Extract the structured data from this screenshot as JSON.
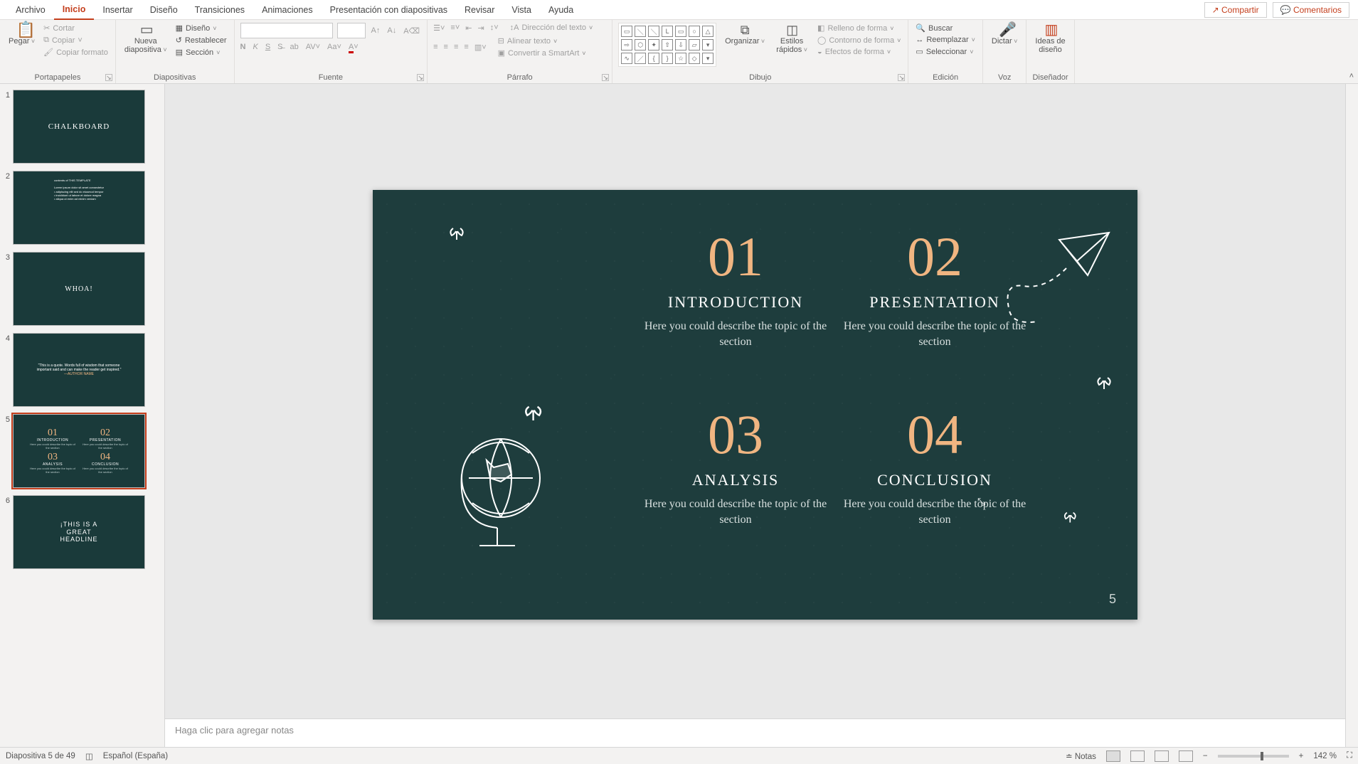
{
  "menu": {
    "file": "Archivo",
    "home": "Inicio",
    "insert": "Insertar",
    "design": "Diseño",
    "transitions": "Transiciones",
    "animations": "Animaciones",
    "slideshow": "Presentación con diapositivas",
    "review": "Revisar",
    "view": "Vista",
    "help": "Ayuda",
    "share": "Compartir",
    "comments": "Comentarios"
  },
  "ribbon": {
    "clipboard": {
      "label": "Portapapeles",
      "paste": "Pegar",
      "cut": "Cortar",
      "copy": "Copiar",
      "formatPainter": "Copiar formato"
    },
    "slides": {
      "label": "Diapositivas",
      "newSlide": "Nueva\ndiapositiva",
      "layout": "Diseño",
      "reset": "Restablecer",
      "section": "Sección"
    },
    "font": {
      "label": "Fuente",
      "name": "",
      "size": ""
    },
    "paragraph": {
      "label": "Párrafo",
      "textDir": "Dirección del texto",
      "alignText": "Alinear texto",
      "smartArt": "Convertir a SmartArt"
    },
    "drawing": {
      "label": "Dibujo",
      "arrange": "Organizar",
      "quickStyles": "Estilos\nrápidos",
      "shapeFill": "Relleno de forma",
      "shapeOutline": "Contorno de forma",
      "shapeEffects": "Efectos de forma"
    },
    "editing": {
      "label": "Edición",
      "find": "Buscar",
      "replace": "Reemplazar",
      "select": "Seleccionar"
    },
    "voice": {
      "label": "Voz",
      "dictate": "Dictar"
    },
    "designer": {
      "label": "Diseñador",
      "ideas": "Ideas de\ndiseño"
    }
  },
  "slide": {
    "pageNumber": "5",
    "sections": [
      {
        "num": "01",
        "title": "INTRODUCTION",
        "desc": "Here you could describe the topic of the section"
      },
      {
        "num": "02",
        "title": "PRESENTATION",
        "desc": "Here you could describe the topic of the section"
      },
      {
        "num": "03",
        "title": "ANALYSIS",
        "desc": "Here you could describe the topic of the section"
      },
      {
        "num": "04",
        "title": "CONCLUSION",
        "desc": "Here you could describe the topic of the section"
      }
    ]
  },
  "thumbs": {
    "t1": "CHALKBOARD",
    "t3": "WHOA!",
    "t6a": "¡THIS IS A",
    "t6b": "GREAT",
    "t6c": "HEADLINE"
  },
  "notes": {
    "placeholder": "Haga clic para agregar notas"
  },
  "status": {
    "slideCount": "Diapositiva 5 de 49",
    "language": "Español (España)",
    "notesBtn": "Notas",
    "zoom": "142 %"
  }
}
